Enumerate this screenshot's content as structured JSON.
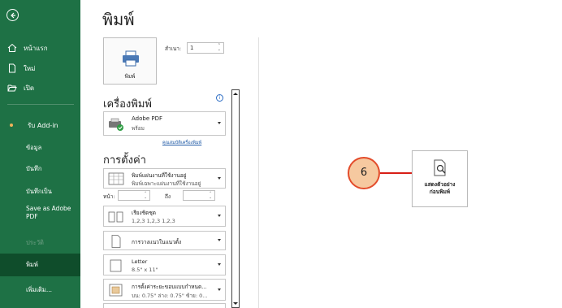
{
  "sidebar": {
    "items": [
      {
        "label": "หน้าแรก",
        "icon": "home-icon"
      },
      {
        "label": "ใหม่",
        "icon": "new-file-icon"
      },
      {
        "label": "เปิด",
        "icon": "folder-open-icon"
      }
    ],
    "sub_items": [
      {
        "label": "รับ Add-in"
      },
      {
        "label": "ข้อมูล"
      },
      {
        "label": "บันทึก"
      },
      {
        "label": "บันทึกเป็น"
      },
      {
        "label": "Save as Adobe PDF"
      },
      {
        "label": "ประวัติ"
      },
      {
        "label": "พิมพ์"
      },
      {
        "label": "เพิ่มเติม..."
      }
    ]
  },
  "main": {
    "title": "พิมพ์",
    "print_button": "พิมพ์",
    "copies_label": "สำเนา:",
    "copies_value": "1",
    "printer_section": "เครื่องพิมพ์",
    "printer": {
      "name": "Adobe PDF",
      "status": "พร้อม"
    },
    "printer_link": "คุณสมบัติเครื่องพิมพ์",
    "settings_section": "การตั้งค่า",
    "settings": [
      {
        "line1": "พิมพ์แผ่นงานที่ใช้งานอยู่",
        "line2": "พิมพ์เฉพาะแผ่นงานที่ใช้งานอยู่",
        "icon": "sheet-icon"
      },
      {
        "line1": "เรียงชิดชุด",
        "line2": "1,2,3   1,2,3   1,2,3",
        "icon": "collate-icon"
      },
      {
        "line1": "การวางแนวในแนวตั้ง",
        "line2": "",
        "icon": "portrait-icon"
      },
      {
        "line1": "Letter",
        "line2": "8.5\" x 11\"",
        "icon": "paper-size-icon"
      },
      {
        "line1": "การตั้งค่าระยะขอบแบบกำหนด...",
        "line2": "บน: 0.75\" ล่าง: 0.75\" ซ้าย: 0...",
        "icon": "margins-icon"
      }
    ],
    "pages_label": "หน้า:",
    "pages_to_label": "ถึง",
    "pages_from": "",
    "pages_to": ""
  },
  "callout": {
    "number": "6"
  },
  "preview_button": {
    "line1": "แสดงตัวอย่าง",
    "line2": "ก่อนพิมพ์"
  },
  "colors": {
    "sidebar": "#1e7145",
    "sidebar_active": "#0f4d2b",
    "accent": "#d81f16",
    "badge": "#f6c9a0"
  }
}
